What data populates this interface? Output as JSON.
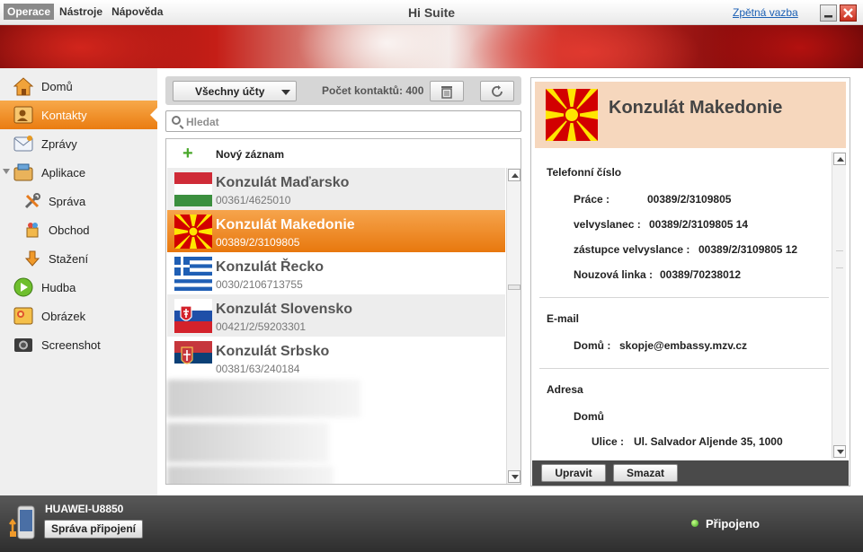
{
  "app": {
    "title": "Hi Suite",
    "feedback_link": "Zpětná vazba",
    "menu": [
      "Operace",
      "Nástroje",
      "Nápověda"
    ]
  },
  "sidebar": {
    "items": [
      {
        "label": "Domů",
        "icon": "home-icon"
      },
      {
        "label": "Kontakty",
        "icon": "contacts-icon"
      },
      {
        "label": "Zprávy",
        "icon": "messages-icon"
      },
      {
        "label": "Aplikace",
        "icon": "apps-icon"
      },
      {
        "label": "Správa",
        "icon": "tools-icon"
      },
      {
        "label": "Obchod",
        "icon": "store-icon"
      },
      {
        "label": "Stažení",
        "icon": "download-icon"
      },
      {
        "label": "Hudba",
        "icon": "music-icon"
      },
      {
        "label": "Obrázek",
        "icon": "picture-icon"
      },
      {
        "label": "Screenshot",
        "icon": "camera-icon"
      }
    ],
    "selected": "Kontakty"
  },
  "contacts": {
    "account_filter": "Všechny účty",
    "count_label": "Počet kontaktů: 400",
    "search_placeholder": "Hledat",
    "new_entry": "Nový záznam",
    "list": [
      {
        "name": "Konzulát Maďarsko",
        "phone": "00361/4625010",
        "flag": "hungary-flag-icon"
      },
      {
        "name": "Konzulát Makedonie",
        "phone": "00389/2/3109805",
        "flag": "macedonia-flag-icon"
      },
      {
        "name": "Konzulát Řecko",
        "phone": "0030/2106713755",
        "flag": "greece-flag-icon"
      },
      {
        "name": "Konzulát Slovensko",
        "phone": "00421/2/59203301",
        "flag": "slovakia-flag-icon"
      },
      {
        "name": "Konzulát Srbsko",
        "phone": "00381/63/240184",
        "flag": "serbia-flag-icon"
      }
    ],
    "selected_index": 1
  },
  "detail": {
    "title": "Konzulát Makedonie",
    "phone_section": "Telefonní číslo",
    "phones": [
      {
        "label": "Práce :",
        "value": "00389/2/3109805"
      },
      {
        "label": "velvyslanec :",
        "value": "00389/2/3109805 14"
      },
      {
        "label": "zástupce velvyslance :",
        "value": "00389/2/3109805 12"
      },
      {
        "label": "Nouzová linka :",
        "value": "00389/70238012"
      }
    ],
    "email_section": "E-mail",
    "email": {
      "label": "Domů :",
      "value": "skopje@embassy.mzv.cz"
    },
    "address_section": "Adresa",
    "address_type": "Domů",
    "address": {
      "label": "Ulice :",
      "value": "Ul. Salvador Aljende 35, 1000"
    },
    "edit_button": "Upravit",
    "delete_button": "Smazat"
  },
  "status": {
    "device": "HUAWEI-U8850",
    "manage_button": "Správa připojení",
    "connection": "Připojeno"
  },
  "colors": {
    "accent_orange": "#ea7c11",
    "detail_header": "#f6d7bd",
    "connected_green": "#3aa31b"
  }
}
